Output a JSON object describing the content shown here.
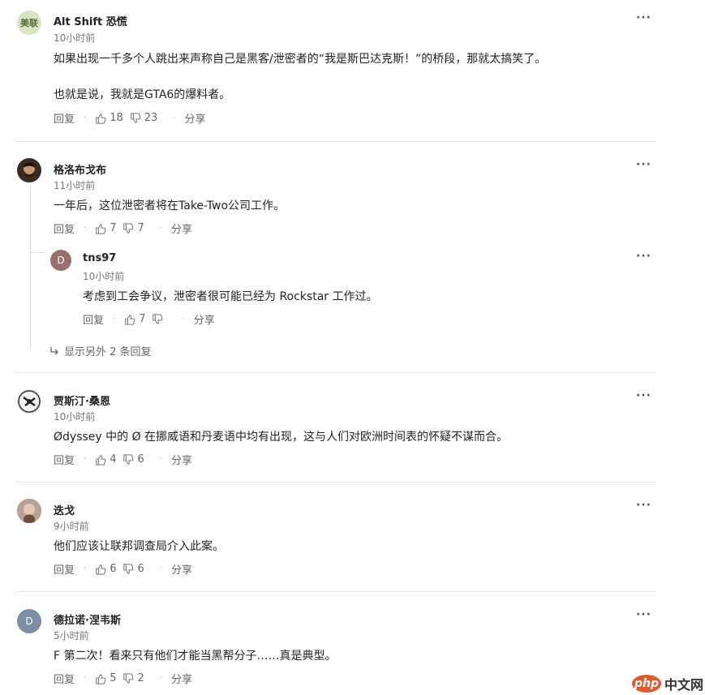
{
  "comments": [
    {
      "username": "Alt Shift 恐慌",
      "avatar_text": "美联",
      "avatar_color": "#d8e4c4",
      "time": "10小时前",
      "lines": [
        "如果出现一千多个人跳出来声称自己是黑客/泄密者的“我是斯巴达克斯！”的桥段，那就太搞笑了。",
        "也就是说，我就是GTA6的爆料者。"
      ],
      "reply": "回复",
      "up": "18",
      "down": "23",
      "share": "分享"
    },
    {
      "username": "格洛布戈布",
      "avatar_color": "#3b2a20",
      "time": "11小时前",
      "lines": [
        "一年后，这位泄密者将在Take-Two公司工作。"
      ],
      "reply": "回复",
      "up": "7",
      "down": "7",
      "share": "分享"
    },
    {
      "username": "tns97",
      "avatar_text": "D",
      "avatar_color": "#9a6e6a",
      "time": "10小时前",
      "lines": [
        "考虑到工会争议，泄密者很可能已经为 Rockstar 工作过。"
      ],
      "reply": "回复",
      "up": "7",
      "down": "",
      "share": "分享"
    },
    {
      "username": "贾斯汀·桑恩",
      "avatar_color": "#3a3a3a",
      "time": "10小时前",
      "lines": [
        "Ødyssey 中的 Ø 在挪威语和丹麦语中均有出现，这与人们对欧洲时间表的怀疑不谋而合。"
      ],
      "reply": "回复",
      "up": "4",
      "down": "6",
      "share": "分享"
    },
    {
      "username": "迭戈",
      "avatar_color": "#8a6b5c",
      "time": "9小时前",
      "lines": [
        "他们应该让联邦调查局介入此案。"
      ],
      "reply": "回复",
      "up": "6",
      "down": "6",
      "share": "分享"
    },
    {
      "username": "德拉诺·涅韦斯",
      "avatar_text": "D",
      "avatar_color": "#7d8fa3",
      "time": "5小时前",
      "lines": [
        "F 第二次！看来只有他们才能当黑帮分子……真是典型。"
      ],
      "reply": "回复",
      "up": "5",
      "down": "2",
      "share": "分享"
    }
  ],
  "show_more_replies": "显示另外 2 条回复",
  "more_menu": "···",
  "separator": "·",
  "watermark": {
    "logo": "php",
    "text": "中文网"
  }
}
